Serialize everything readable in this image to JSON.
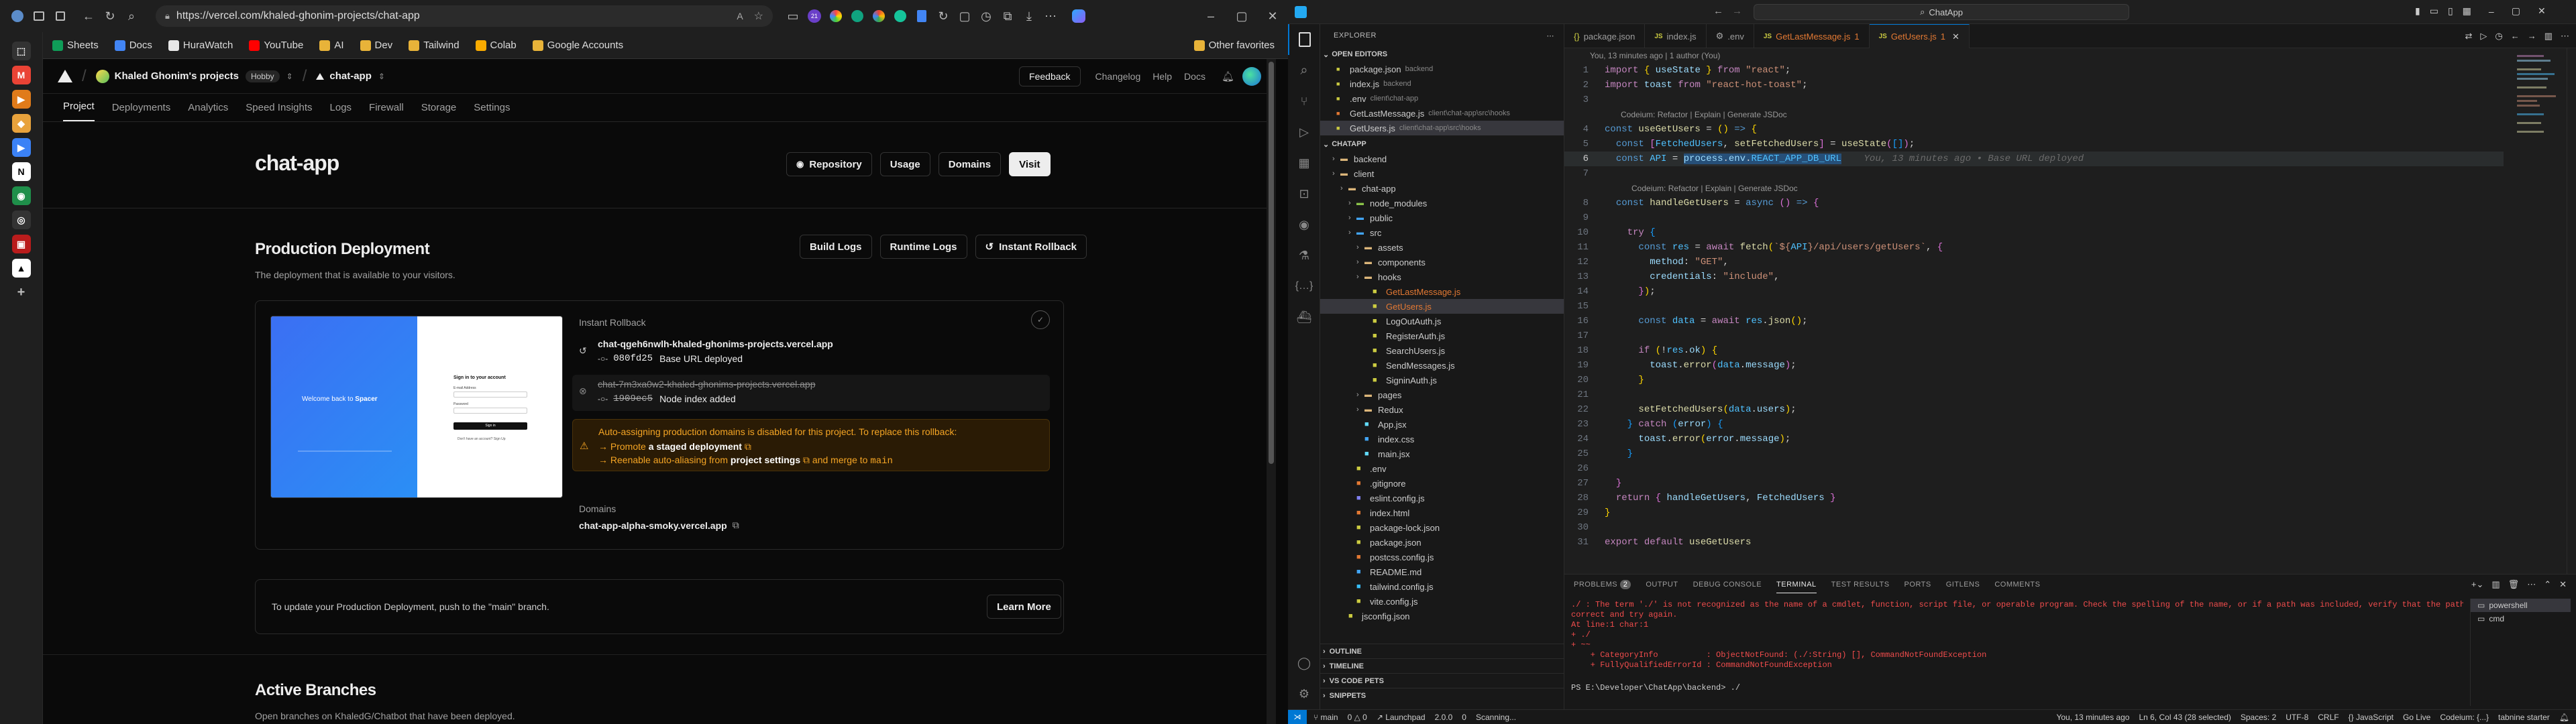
{
  "browser": {
    "url": "https://vercel.com/khaled-ghonim-projects/chat-app",
    "bookmarks": [
      {
        "label": "Sheets",
        "color": "#0f9d58"
      },
      {
        "label": "Docs",
        "color": "#4285f4"
      },
      {
        "label": "HuraWatch",
        "color": "#e8e8e8"
      },
      {
        "label": "YouTube",
        "color": "#ff0000"
      },
      {
        "label": "AI",
        "color": "#e8b339"
      },
      {
        "label": "Dev",
        "color": "#e8b339"
      },
      {
        "label": "Tailwind",
        "color": "#e8b339"
      },
      {
        "label": "Colab",
        "color": "#f9ab00"
      },
      {
        "label": "Google Accounts",
        "color": "#e8b339"
      }
    ],
    "other_favorites": "Other favorites"
  },
  "vercel": {
    "team": "Khaled Ghonim's projects",
    "plan": "Hobby",
    "project": "chat-app",
    "top_links": {
      "feedback": "Feedback",
      "changelog": "Changelog",
      "help": "Help",
      "docs": "Docs"
    },
    "tabs": [
      "Project",
      "Deployments",
      "Analytics",
      "Speed Insights",
      "Logs",
      "Firewall",
      "Storage",
      "Settings"
    ],
    "title": "chat-app",
    "actions": {
      "repository": "Repository",
      "usage": "Usage",
      "domains": "Domains",
      "visit": "Visit"
    },
    "production": {
      "heading": "Production Deployment",
      "subtitle": "The deployment that is available to your visitors.",
      "build_logs": "Build Logs",
      "runtime_logs": "Runtime Logs",
      "instant_rollback": "Instant Rollback"
    },
    "preview": {
      "welcome": "Welcome back to",
      "brand": "Spacer",
      "signin_title": "Sign in to your account",
      "email_label": "E-mail Address",
      "password_label": "Password",
      "submit": "Sign in",
      "footer": "Don't have an account? Sign Up"
    },
    "rollback": {
      "label": "Instant Rollback",
      "current_url": "chat-qgeh6nwlh-khaled-ghonims-projects.vercel.app",
      "current_commit": "080fd25",
      "current_message": "Base URL deployed",
      "prev_url": "chat-7m3xa0w2-khaled-ghonims-projects.vercel.app",
      "prev_commit": "1909ec5",
      "prev_message": "Node index added"
    },
    "warning": {
      "text": "Auto-assigning production domains is disabled for this project. To replace this rollback:",
      "line1_prefix": "Promote",
      "line1_link": "a staged deployment",
      "line2_prefix": "Reenable auto-aliasing from",
      "line2_link": "project settings",
      "line2_suffix": "and merge to",
      "line2_branch": "main"
    },
    "domains_label": "Domains",
    "domain": "chat-app-alpha-smoky.vercel.app",
    "update_text": "To update your Production Deployment, push to the \"main\" branch.",
    "learn_more": "Learn More",
    "branches_heading": "Active Branches",
    "branches_sub": "Open branches on KhaledG/Chatbot that have been deployed."
  },
  "vscode": {
    "search": "ChatApp",
    "explorer_label": "EXPLORER",
    "open_editors_label": "OPEN EDITORS",
    "open_editors": [
      {
        "name": "package.json",
        "path": "backend",
        "color": "#cbcb41"
      },
      {
        "name": "index.js",
        "path": "backend",
        "color": "#cbcb41"
      },
      {
        "name": ".env",
        "path": "client\\chat-app",
        "color": "#cbcb41"
      },
      {
        "name": "GetLastMessage.js",
        "path": "client\\chat-app\\src\\hooks",
        "color": "#e37933"
      },
      {
        "name": "GetUsers.js",
        "path": "client\\chat-app\\src\\hooks",
        "color": "#cbcb41"
      }
    ],
    "project_label": "CHATAPP",
    "tree": [
      {
        "name": "backend",
        "depth": 1,
        "type": "folder",
        "color": "#dcb67a"
      },
      {
        "name": "client",
        "depth": 1,
        "type": "folder",
        "color": "#dcb67a"
      },
      {
        "name": "chat-app",
        "depth": 2,
        "type": "folder",
        "color": "#dcb67a"
      },
      {
        "name": "node_modules",
        "depth": 3,
        "type": "folder",
        "color": "#8bc34a"
      },
      {
        "name": "public",
        "depth": 3,
        "type": "folder",
        "color": "#42a5f5"
      },
      {
        "name": "src",
        "depth": 3,
        "type": "folder",
        "color": "#42a5f5"
      },
      {
        "name": "assets",
        "depth": 4,
        "type": "folder",
        "color": "#dcb67a"
      },
      {
        "name": "components",
        "depth": 4,
        "type": "folder",
        "color": "#dcb67a"
      },
      {
        "name": "hooks",
        "depth": 4,
        "type": "folder",
        "color": "#dcb67a"
      },
      {
        "name": "GetLastMessage.js",
        "depth": 5,
        "type": "file",
        "color": "#cbcb41"
      },
      {
        "name": "GetUsers.js",
        "depth": 5,
        "type": "file",
        "color": "#cbcb41"
      },
      {
        "name": "LogOutAuth.js",
        "depth": 5,
        "type": "file",
        "color": "#cbcb41"
      },
      {
        "name": "RegisterAuth.js",
        "depth": 5,
        "type": "file",
        "color": "#cbcb41"
      },
      {
        "name": "SearchUsers.js",
        "depth": 5,
        "type": "file",
        "color": "#cbcb41"
      },
      {
        "name": "SendMessages.js",
        "depth": 5,
        "type": "file",
        "color": "#cbcb41"
      },
      {
        "name": "SigninAuth.js",
        "depth": 5,
        "type": "file",
        "color": "#cbcb41"
      },
      {
        "name": "pages",
        "depth": 4,
        "type": "folder",
        "color": "#dcb67a"
      },
      {
        "name": "Redux",
        "depth": 4,
        "type": "folder",
        "color": "#dcb67a"
      },
      {
        "name": "App.jsx",
        "depth": 4,
        "type": "file",
        "color": "#61dafb"
      },
      {
        "name": "index.css",
        "depth": 4,
        "type": "file",
        "color": "#42a5f5"
      },
      {
        "name": "main.jsx",
        "depth": 4,
        "type": "file",
        "color": "#61dafb"
      },
      {
        "name": ".env",
        "depth": 3,
        "type": "file",
        "color": "#cbcb41"
      },
      {
        "name": ".gitignore",
        "depth": 3,
        "type": "file",
        "color": "#e37933"
      },
      {
        "name": "eslint.config.js",
        "depth": 3,
        "type": "file",
        "color": "#8080f2"
      },
      {
        "name": "index.html",
        "depth": 3,
        "type": "file",
        "color": "#e37933"
      },
      {
        "name": "package-lock.json",
        "depth": 3,
        "type": "file",
        "color": "#cbcb41"
      },
      {
        "name": "package.json",
        "depth": 3,
        "type": "file",
        "color": "#cbcb41"
      },
      {
        "name": "postcss.config.js",
        "depth": 3,
        "type": "file",
        "color": "#e37933"
      },
      {
        "name": "README.md",
        "depth": 3,
        "type": "file",
        "color": "#42a5f5"
      },
      {
        "name": "tailwind.config.js",
        "depth": 3,
        "type": "file",
        "color": "#38bdf8"
      },
      {
        "name": "vite.config.js",
        "depth": 3,
        "type": "file",
        "color": "#cbcb41"
      },
      {
        "name": "jsconfig.json",
        "depth": 2,
        "type": "file",
        "color": "#cbcb41"
      }
    ],
    "bottom_sections": [
      "OUTLINE",
      "TIMELINE",
      "VS CODE PETS",
      "SNIPPETS"
    ],
    "editor_tabs": [
      {
        "name": "package.json",
        "active": false,
        "color": "#cbcb41"
      },
      {
        "name": "index.js",
        "active": false,
        "color": "#cbcb41"
      },
      {
        "name": ".env",
        "active": false,
        "color": "#cbcb41"
      },
      {
        "name": "GetLastMessage.js",
        "active": false,
        "color": "#e37933"
      },
      {
        "name": "GetUsers.js",
        "active": true,
        "color": "#cbcb41"
      }
    ],
    "blame_top": "You, 13 minutes ago | 1 author (You)",
    "lens": "Codeium: Refactor | Explain | Generate JSDoc",
    "inline_blame": "You, 13 minutes ago • Base URL deployed",
    "panel_tabs": [
      "PROBLEMS",
      "OUTPUT",
      "DEBUG CONSOLE",
      "TERMINAL",
      "TEST RESULTS",
      "PORTS",
      "GITLENS",
      "COMMENTS"
    ],
    "problems_count": "2",
    "terminal": [
      "./ : The term './' is not recognized as the name of a cmdlet, function, script file, or operable program. Check the spelling of the name, or if a path was included, verify that the path is",
      "correct and try again.",
      "At line:1 char:1",
      "+ ./",
      "+ ~~",
      "    + CategoryInfo          : ObjectNotFound: (./:String) [], CommandNotFoundException",
      "    + FullyQualifiedErrorId : CommandNotFoundException",
      "",
      "PS E:\\Developer\\ChatApp\\backend> ./"
    ],
    "terminals": [
      "powershell",
      "cmd"
    ],
    "status_left": [
      "main",
      "0 △ 0",
      "Launchpad",
      "2.0.0",
      "0",
      "Scanning..."
    ],
    "status_right": [
      "You, 13 minutes ago",
      "Ln 6, Col 43 (28 selected)",
      "Spaces: 2",
      "UTF-8",
      "CRLF",
      "{} JavaScript",
      "Go Live",
      "Codeium: {...}",
      "tabnine starter"
    ]
  }
}
